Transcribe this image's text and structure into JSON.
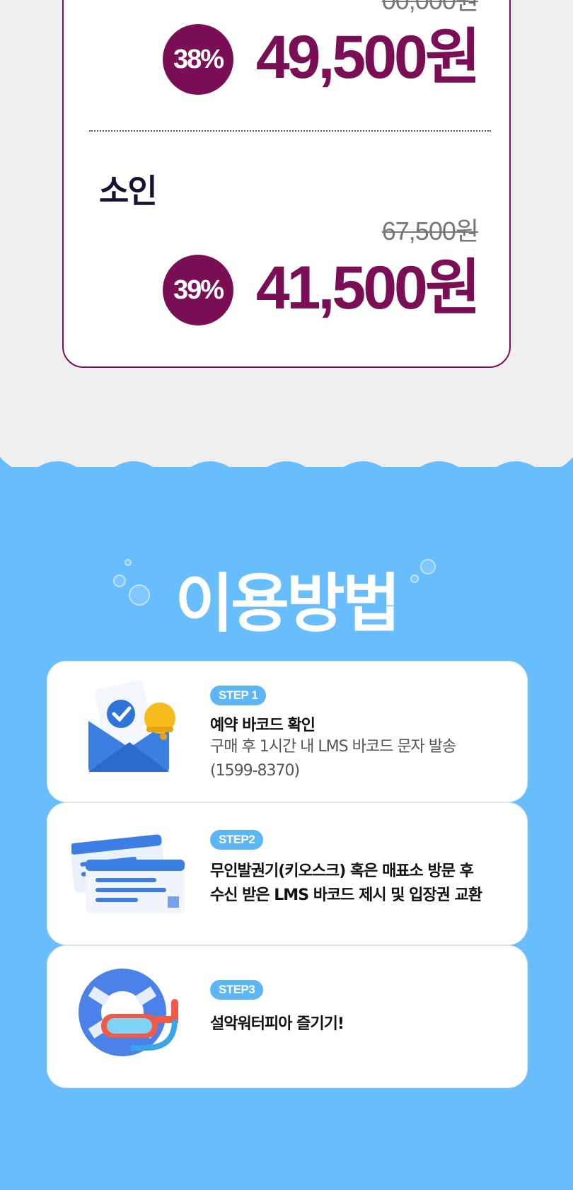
{
  "price_card": {
    "first": {
      "original_price_partial": "00,000원",
      "discount": "38%",
      "price": "49,500원"
    },
    "child": {
      "label": "소인",
      "original_price": "67,500원",
      "discount": "39%",
      "price": "41,500원"
    }
  },
  "usage": {
    "title": "이용방법",
    "steps": [
      {
        "badge": "STEP 1",
        "title": "예약 바코드 확인",
        "line1": "구매 후 1시간 내 LMS 바코드 문자 발송",
        "line2": "(1599-8370)",
        "icon": "envelope-bell-icon"
      },
      {
        "badge": "STEP2",
        "line1": "무인발권기(키오스크) 혹은 매표소 방문 후",
        "line2": "수신 받은 LMS 바코드 제시 및 입장권 교환",
        "icon": "tickets-icon"
      },
      {
        "badge": "STEP3",
        "title": "설악워터피아 즐기기!",
        "icon": "swim-ring-goggles-icon"
      }
    ]
  },
  "colors": {
    "accent": "#7a0f55",
    "sky": "#68bdfc",
    "badge_blue": "#5bb6f3"
  }
}
